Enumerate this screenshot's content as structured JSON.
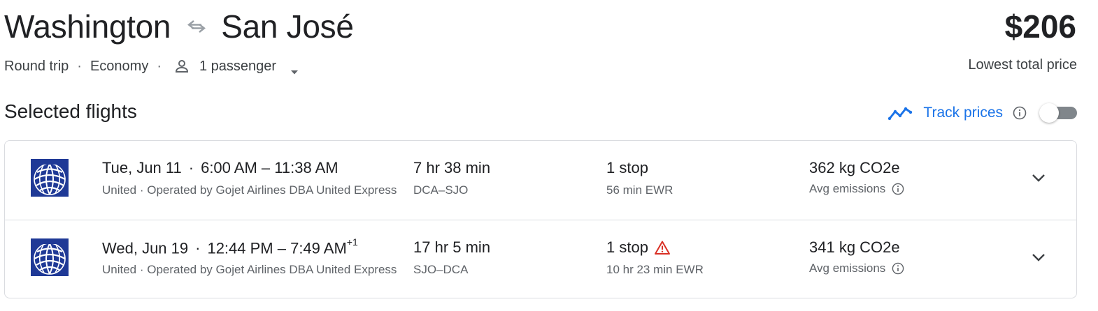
{
  "route": {
    "origin": "Washington",
    "destination": "San José",
    "swap_icon": "swap-arrows-icon"
  },
  "trip": {
    "type": "Round trip",
    "separator": "·",
    "cabin": "Economy",
    "passengers": "1 passenger",
    "passenger_icon": "person-icon",
    "dropdown_icon": "caret-down-icon"
  },
  "price": {
    "amount": "$206",
    "caption": "Lowest total price"
  },
  "section_title": "Selected flights",
  "track": {
    "label": "Track prices",
    "enabled": false,
    "accent_color": "#1a73e8"
  },
  "flights": [
    {
      "date": "Tue, Jun 11",
      "separator": "·",
      "times": "6:00 AM – 11:38 AM",
      "day_offset": "",
      "airline": "United · Operated by Gojet Airlines DBA United Express",
      "duration": "7 hr 38 min",
      "airports": "DCA–SJO",
      "stops": "1 stop",
      "stop_warning": false,
      "layover": "56 min EWR",
      "emissions": "362 kg CO2e",
      "emissions_label": "Avg emissions"
    },
    {
      "date": "Wed, Jun 19",
      "separator": "·",
      "times": "12:44 PM – 7:49 AM",
      "day_offset": "+1",
      "airline": "United · Operated by Gojet Airlines DBA United Express",
      "duration": "17 hr 5 min",
      "airports": "SJO–DCA",
      "stops": "1 stop",
      "stop_warning": true,
      "layover": "10 hr 23 min EWR",
      "emissions": "341 kg CO2e",
      "emissions_label": "Avg emissions"
    }
  ],
  "colors": {
    "text_primary": "#202124",
    "text_secondary": "#5f6368",
    "border": "#dadce0",
    "warning": "#d93025",
    "logo_blue": "#1f3996"
  }
}
